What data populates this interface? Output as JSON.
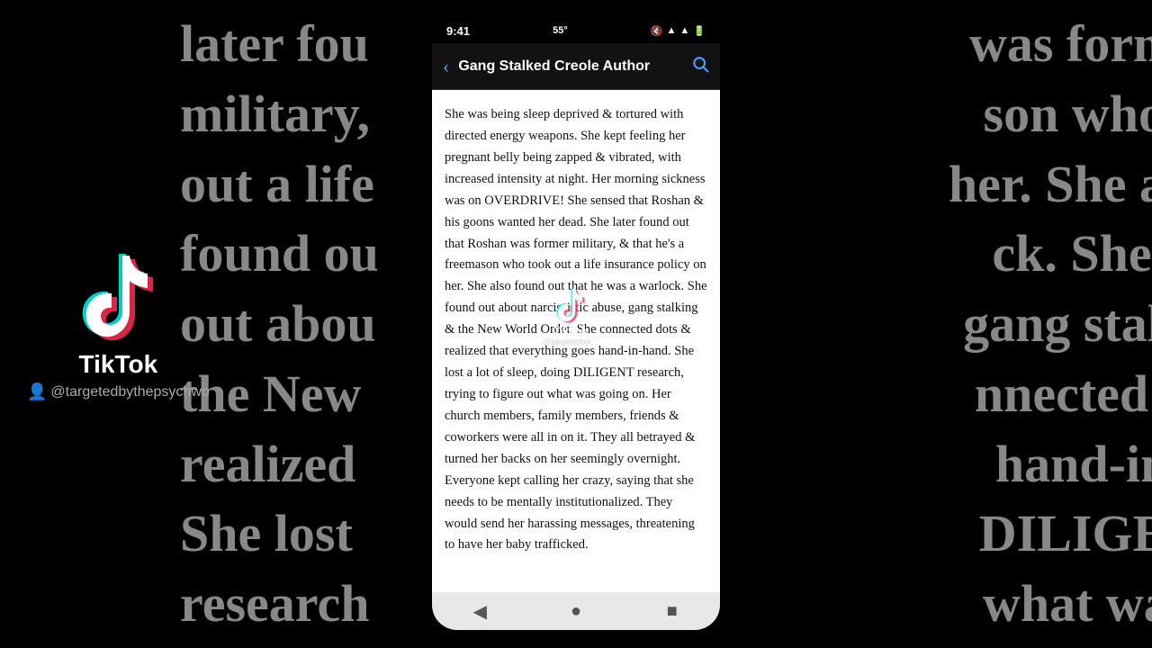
{
  "background": {
    "lines": [
      "later fou",
      "military,",
      "out a life",
      "found ou",
      "out abou",
      "the New",
      "realized",
      "She lost ",
      "research"
    ],
    "right_lines": [
      "was former",
      "son who took",
      "her. She also",
      "ck. She found",
      "gang stalking &",
      "nnected dots &",
      "hand-in-hand.",
      "DILIGENT",
      "what was going"
    ]
  },
  "tiktok": {
    "label": "TikTok",
    "username": "@targetedbythepsychwo"
  },
  "status_bar": {
    "time": "9:41",
    "signal": "55°"
  },
  "header": {
    "title": "Gang Stalked Creole Author",
    "back_label": "‹",
    "search_icon": "🔍"
  },
  "article": {
    "text": "She was being sleep deprived & tortured with directed energy weapons. She kept feeling her pregnant belly being zapped & vibrated, with increased intensity at night. Her morning sickness was on OVERDRIVE! She sensed that Roshan & his goons wanted her dead. She later found out that Roshan was former military, & that he's a freemason who took out a life insurance policy on her. She also found out that he was a warlock. She found out about narcissistic abuse, gang stalking & the New World Order. She connected dots & realized that everything goes hand-in-hand. She lost a lot of sleep, doing DILIGENT research, trying to figure out what was going on. Her church members, family members, friends & coworkers were all in on it. They all betrayed & turned her backs on her seemingly overnight. Everyone kept calling her crazy, saying that she needs to be mentally institutionalized. They would send her harassing messages, threatening to have her baby trafficked."
  },
  "bottom_nav": {
    "back": "◀",
    "home": "●",
    "square": "■"
  }
}
